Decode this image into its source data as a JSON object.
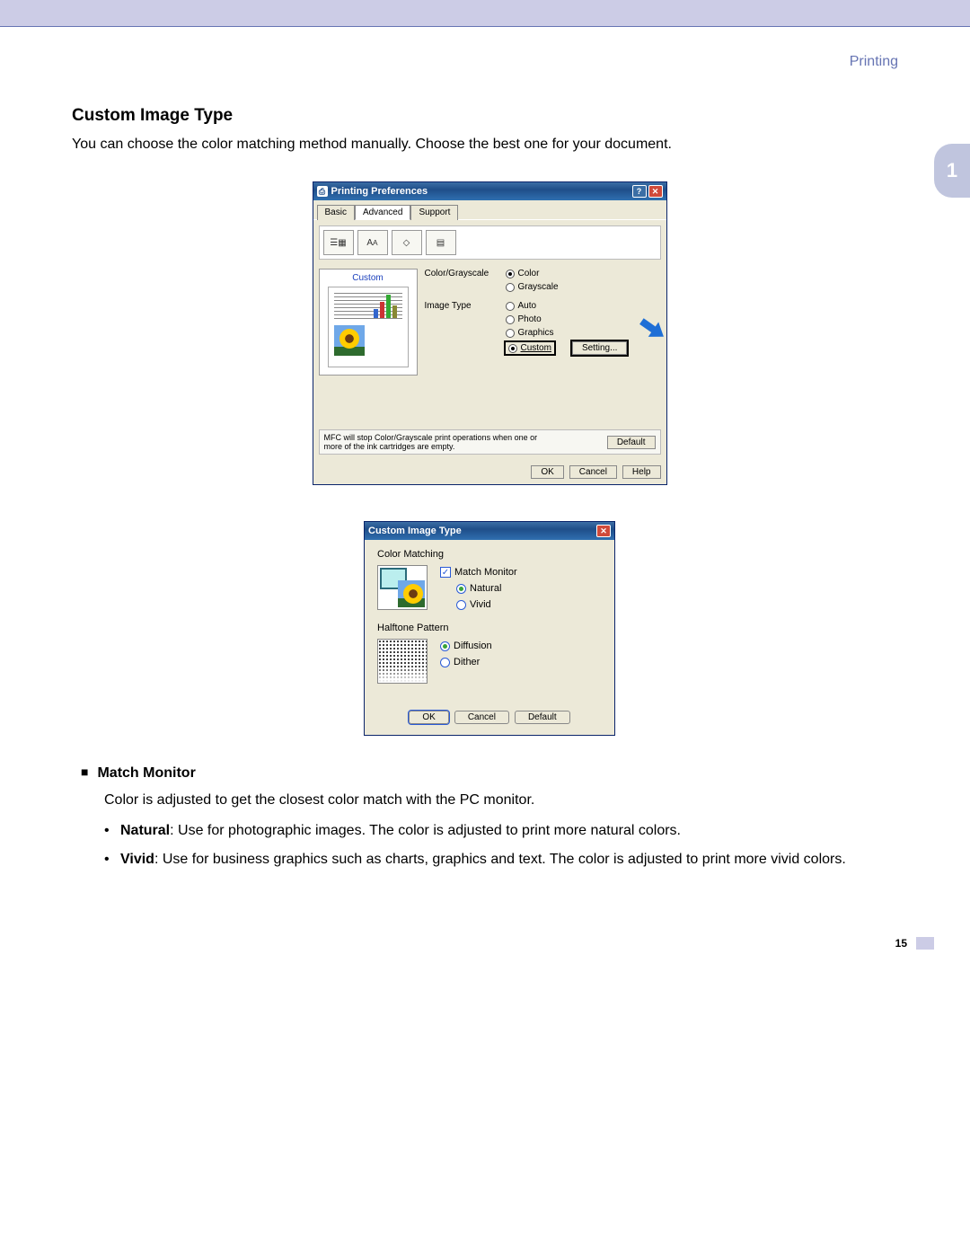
{
  "header": {
    "section": "Printing",
    "chapter_tab": "1",
    "page_number": "15"
  },
  "section": {
    "title": "Custom Image Type",
    "intro": "You can choose the color matching method manually. Choose the best one for your document."
  },
  "dialog1": {
    "title": "Printing Preferences",
    "tabs": [
      "Basic",
      "Advanced",
      "Support"
    ],
    "active_tab": 1,
    "preview_label": "Custom",
    "groups": {
      "color_grayscale": {
        "label": "Color/Grayscale",
        "options": [
          "Color",
          "Grayscale"
        ],
        "selected": 0
      },
      "image_type": {
        "label": "Image Type",
        "options": [
          "Auto",
          "Photo",
          "Graphics",
          "Custom"
        ],
        "selected": 3,
        "setting_button": "Setting..."
      }
    },
    "footer_note": "MFC will stop Color/Grayscale print operations when one or more of the ink cartridges are empty.",
    "default_button": "Default",
    "buttons": [
      "OK",
      "Cancel",
      "Help"
    ]
  },
  "dialog2": {
    "title": "Custom Image Type",
    "color_matching": {
      "label": "Color Matching",
      "checkbox": "Match Monitor",
      "checkbox_checked": true,
      "options": [
        "Natural",
        "Vivid"
      ],
      "selected": 0
    },
    "halftone": {
      "label": "Halftone Pattern",
      "options": [
        "Diffusion",
        "Dither"
      ],
      "selected": 0
    },
    "buttons": [
      "OK",
      "Cancel",
      "Default"
    ]
  },
  "body_text": {
    "match_monitor_heading": "Match Monitor",
    "match_monitor_desc": "Color is adjusted to get the closest color match with the PC monitor.",
    "natural_label": "Natural",
    "natural_desc": ": Use for photographic images. The color is adjusted to print more natural colors.",
    "vivid_label": "Vivid",
    "vivid_desc": ": Use for business graphics such as charts, graphics and text. The color is adjusted to print more vivid colors."
  }
}
